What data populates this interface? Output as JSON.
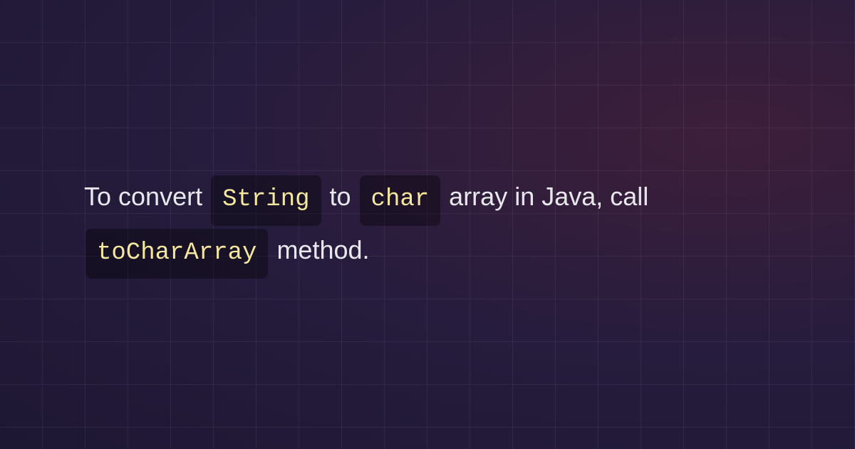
{
  "sentence": {
    "part1": "To convert ",
    "code1": "String",
    "part2": " to ",
    "code2": "char",
    "part3": " array in Java, call ",
    "code3": "toCharArray",
    "part4": " method."
  }
}
